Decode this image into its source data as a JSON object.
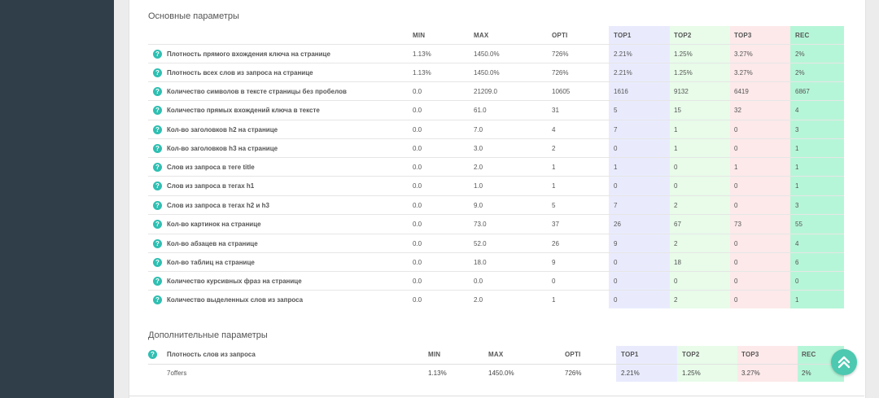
{
  "main_section": {
    "title": "Основные параметры",
    "columns": [
      "MIN",
      "MAX",
      "OPTI",
      "TOP1",
      "TOP2",
      "TOP3",
      "REC"
    ],
    "rows": [
      {
        "label": "Плотность прямого вхождения ключа на странице",
        "values": [
          "1.13%",
          "1450.0%",
          "726%",
          "2.21%",
          "1.25%",
          "3.27%",
          "2%"
        ]
      },
      {
        "label": "Плотность всех слов из запроса на странице",
        "values": [
          "1.13%",
          "1450.0%",
          "726%",
          "2.21%",
          "1.25%",
          "3.27%",
          "2%"
        ]
      },
      {
        "label": "Количество символов в тексте страницы без пробелов",
        "values": [
          "0.0",
          "21209.0",
          "10605",
          "1616",
          "9132",
          "6419",
          "6867"
        ]
      },
      {
        "label": "Количество прямых вхождений ключа в тексте",
        "values": [
          "0.0",
          "61.0",
          "31",
          "5",
          "15",
          "32",
          "4"
        ]
      },
      {
        "label": "Кол-во заголовков h2 на странице",
        "values": [
          "0.0",
          "7.0",
          "4",
          "7",
          "1",
          "0",
          "3"
        ]
      },
      {
        "label": "Кол-во заголовков h3 на странице",
        "values": [
          "0.0",
          "3.0",
          "2",
          "0",
          "1",
          "0",
          "1"
        ]
      },
      {
        "label": "Слов из запроса в теге title",
        "values": [
          "0.0",
          "2.0",
          "1",
          "1",
          "0",
          "1",
          "1"
        ]
      },
      {
        "label": "Слов из запроса в тегах h1",
        "values": [
          "0.0",
          "1.0",
          "1",
          "0",
          "0",
          "0",
          "1"
        ]
      },
      {
        "label": "Слов из запроса в тегах h2 и h3",
        "values": [
          "0.0",
          "9.0",
          "5",
          "7",
          "2",
          "0",
          "3"
        ]
      },
      {
        "label": "Кол-во картинок на странице",
        "values": [
          "0.0",
          "73.0",
          "37",
          "26",
          "67",
          "73",
          "55"
        ]
      },
      {
        "label": "Кол-во абзацев на странице",
        "values": [
          "0.0",
          "52.0",
          "26",
          "9",
          "2",
          "0",
          "4"
        ]
      },
      {
        "label": "Кол-во таблиц на странице",
        "values": [
          "0.0",
          "18.0",
          "9",
          "0",
          "18",
          "0",
          "6"
        ]
      },
      {
        "label": "Количество курсивных фраз на странице",
        "values": [
          "0.0",
          "0.0",
          "0",
          "0",
          "0",
          "0",
          "0"
        ]
      },
      {
        "label": "Количество выделенных слов из запроса",
        "values": [
          "0.0",
          "2.0",
          "1",
          "0",
          "2",
          "0",
          "1"
        ]
      }
    ]
  },
  "extra_section": {
    "title": "Дополнительные параметры",
    "header_label": "Плотность слов из запроса",
    "columns": [
      "MIN",
      "MAX",
      "OPTI",
      "TOP1",
      "TOP2",
      "TOP3",
      "REC"
    ],
    "rows": [
      {
        "label": "7offers",
        "values": [
          "1.13%",
          "1450.0%",
          "726%",
          "2.21%",
          "1.25%",
          "3.27%",
          "2%"
        ]
      }
    ]
  },
  "help_glyph": "?",
  "icons": {
    "help": "help-circle-icon",
    "scroll_top": "double-chevron-up-icon"
  },
  "colors": {
    "sidebar": "#2f3e48",
    "top1": "#e9ebfd",
    "top2": "#e8fce9",
    "top3": "#fde9ea",
    "rec": "#b6f6d8",
    "accent": "#2fbfb2"
  }
}
